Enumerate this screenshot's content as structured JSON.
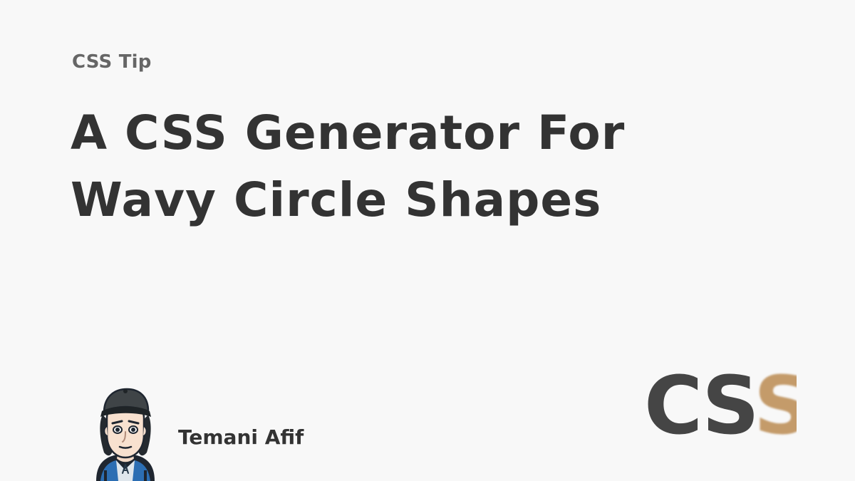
{
  "category": "CSS Tip",
  "title": {
    "line1": "A CSS Generator For",
    "line2": "Wavy Circle Shapes"
  },
  "author": {
    "name": "Temani Afif",
    "avatar_icon": "cartoon-avatar-icon",
    "cap_color": "#3f4447",
    "jacket_color": "#2c6eb3",
    "shirt_color": "#dfe6ec"
  },
  "logo": {
    "text": "CSS",
    "icon": "css-logo-icon",
    "primary_color": "#454545",
    "accent_color": "#c49b6a"
  },
  "colors": {
    "background": "#f8f8f8",
    "title": "#333333",
    "kicker": "#666666"
  }
}
